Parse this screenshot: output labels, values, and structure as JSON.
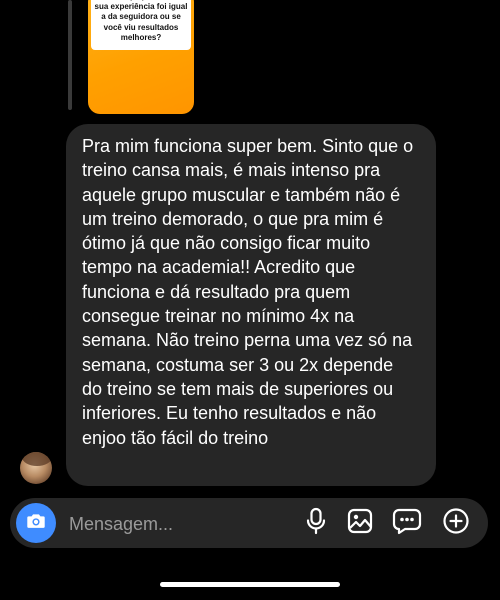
{
  "story_reply": {
    "sticker_text": "Conta aqui pra mim se sua experiência foi igual a da seguidora ou se você viu resultados melhores?"
  },
  "message": {
    "text": "Pra mim funciona super bem. Sinto que o treino cansa mais, é mais intenso pra aquele grupo muscular e também não é um treino demorado, o que pra mim é ótimo já que não consigo ficar muito tempo na academia!! Acredito que funciona e dá resultado pra quem consegue treinar no mínimo 4x na semana. Não treino perna uma vez só na semana, costuma ser 3 ou 2x depende do treino se tem mais de superiores ou inferiores. Eu tenho resultados e não enjoo tão fácil do treino"
  },
  "composer": {
    "placeholder": "Mensagem...",
    "icons": [
      "camera-icon",
      "microphone-icon",
      "gallery-icon",
      "sticker-icon",
      "plus-circle-icon"
    ]
  },
  "colors": {
    "background": "#000000",
    "bubble": "#262626",
    "accent": "#3f8cff"
  }
}
